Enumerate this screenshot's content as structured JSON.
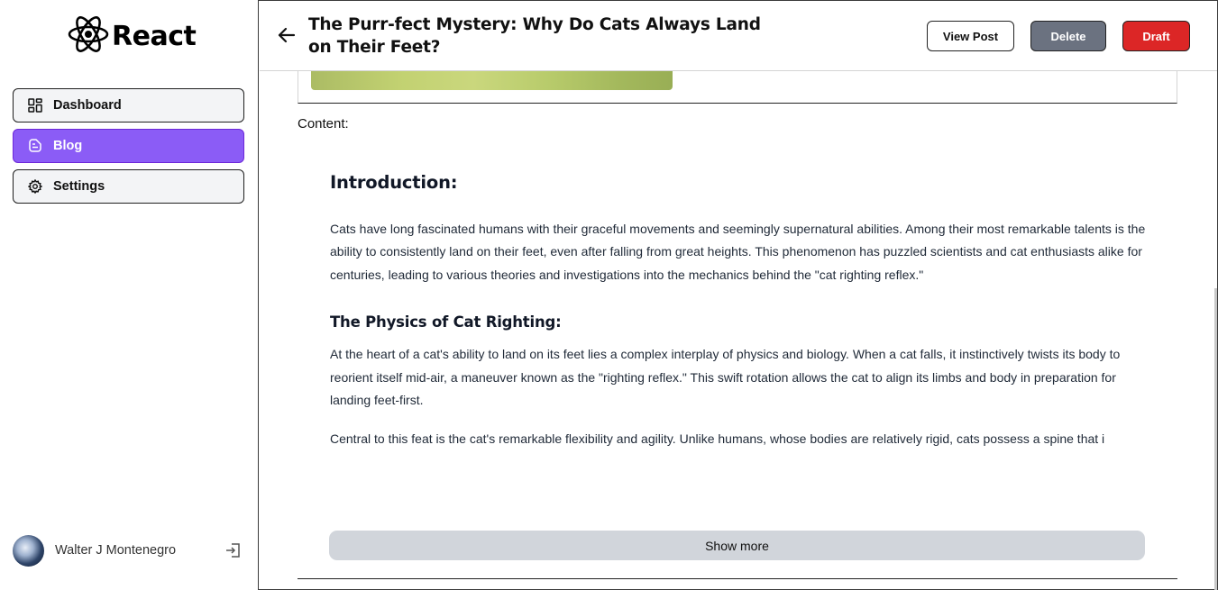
{
  "brand": {
    "name": "React",
    "logo_icon": "react-atom-icon"
  },
  "sidebar": {
    "items": [
      {
        "label": "Dashboard",
        "icon": "dashboard-grid-icon",
        "active": false
      },
      {
        "label": "Blog",
        "icon": "blog-icon",
        "active": true
      },
      {
        "label": "Settings",
        "icon": "gear-icon",
        "active": false
      }
    ],
    "user": {
      "name": "Walter J Montenegro",
      "avatar": "avatar",
      "logout_icon": "logout-icon"
    }
  },
  "header": {
    "title": "The Purr-fect Mystery: Why Do Cats Always Land on Their Feet?",
    "back_icon": "arrow-left-icon",
    "buttons": {
      "view": "View Post",
      "delete": "Delete",
      "draft": "Draft"
    }
  },
  "main": {
    "content_label": "Content:",
    "article": {
      "intro_heading": "Introduction:",
      "intro_text": "Cats have long fascinated humans with their graceful movements and seemingly supernatural abilities. Among their most remarkable talents is the ability to consistently land on their feet, even after falling from great heights. This phenomenon has puzzled scientists and cat enthusiasts alike for centuries, leading to various theories and investigations into the mechanics behind the \"cat righting reflex.\"",
      "physics_heading": "The Physics of Cat Righting:",
      "physics_text": "At the heart of a cat's ability to land on its feet lies a complex interplay of physics and biology. When a cat falls, it instinctively twists its body to reorient itself mid-air, a maneuver known as the \"righting reflex.\" This swift rotation allows the cat to align its limbs and body in preparation for landing feet-first.",
      "flex_text": "Central to this feat is the cat's remarkable flexibility and agility. Unlike humans, whose bodies are relatively rigid, cats possess a spine that i"
    },
    "show_more": "Show more"
  },
  "colors": {
    "active_nav": "#8b5cf6",
    "delete_button": "#6b7280",
    "draft_button": "#dc2626",
    "show_more_bg": "#d1d5db"
  }
}
